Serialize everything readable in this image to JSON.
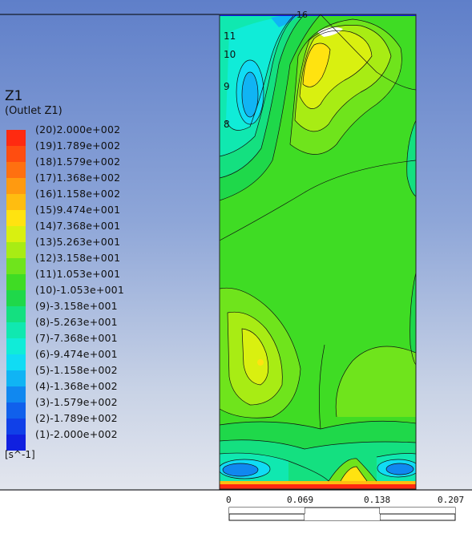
{
  "legend": {
    "title": "Z1",
    "subtitle": "(Outlet  Z1)",
    "units": "[s^-1]",
    "levels": [
      {
        "label": "(20)2.000e+002",
        "color": "#ff2a10"
      },
      {
        "label": "(19)1.789e+002",
        "color": "#ff4d10"
      },
      {
        "label": "(18)1.579e+002",
        "color": "#ff7010"
      },
      {
        "label": "(17)1.368e+002",
        "color": "#ff9a10"
      },
      {
        "label": "(16)1.158e+002",
        "color": "#ffbd10"
      },
      {
        "label": "(15)9.474e+001",
        "color": "#ffe310"
      },
      {
        "label": "(14)7.368e+001",
        "color": "#d9f010"
      },
      {
        "label": "(13)5.263e+001",
        "color": "#a8ec14"
      },
      {
        "label": "(12)3.158e+001",
        "color": "#6fe41c"
      },
      {
        "label": "(11)1.053e+001",
        "color": "#3fdc24"
      },
      {
        "label": "(10)-1.053e+001",
        "color": "#1fd84a"
      },
      {
        "label": "(9)-3.158e+001",
        "color": "#14e080"
      },
      {
        "label": "(8)-5.263e+001",
        "color": "#10e8b0"
      },
      {
        "label": "(7)-7.368e+001",
        "color": "#10ecd8"
      },
      {
        "label": "(6)-9.474e+001",
        "color": "#10dcf4"
      },
      {
        "label": "(5)-1.158e+002",
        "color": "#10b4f4"
      },
      {
        "label": "(4)-1.368e+002",
        "color": "#1088f0"
      },
      {
        "label": "(3)-1.579e+002",
        "color": "#1060ec"
      },
      {
        "label": "(2)-1.789e+002",
        "color": "#1040e8"
      },
      {
        "label": "(1)-2.000e+002",
        "color": "#1020e0"
      }
    ]
  },
  "contour_labels": [
    "11",
    "10",
    "9",
    "8",
    "16"
  ],
  "scale_bar": {
    "ticks": [
      "0",
      "0.069",
      "0.138",
      "0.207"
    ]
  }
}
